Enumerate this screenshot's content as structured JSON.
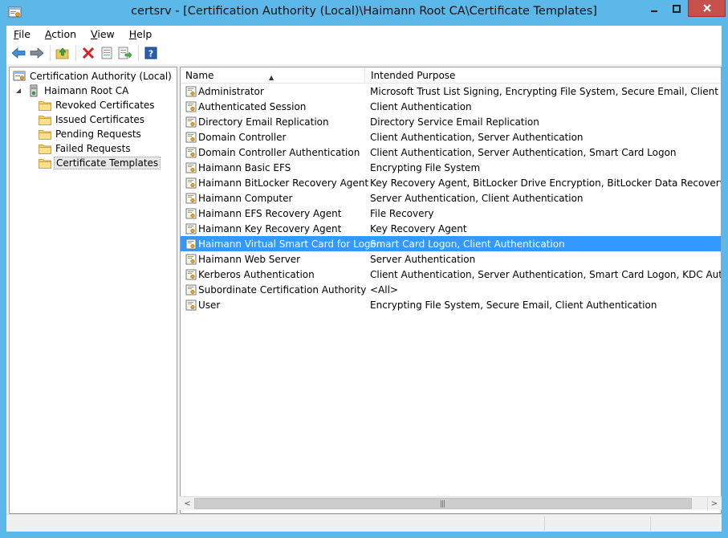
{
  "window": {
    "title": "certsrv - [Certification Authority (Local)\\Haimann Root CA\\Certificate Templates]",
    "icon": "certsrv-app-icon"
  },
  "menu": {
    "file": "File",
    "action": "Action",
    "view": "View",
    "help": "Help"
  },
  "toolbar": {
    "icons": [
      "back-arrow-icon",
      "forward-arrow-icon",
      "up-folder-icon",
      "delete-icon",
      "properties-icon",
      "export-list-icon",
      "help-icon"
    ]
  },
  "tree": {
    "root": "Certification Authority (Local)",
    "ca": "Haimann Root CA",
    "items": [
      {
        "label": "Revoked Certificates"
      },
      {
        "label": "Issued Certificates"
      },
      {
        "label": "Pending Requests"
      },
      {
        "label": "Failed Requests"
      },
      {
        "label": "Certificate Templates",
        "selected": true
      }
    ]
  },
  "list": {
    "columns": {
      "name": "Name",
      "purpose": "Intended Purpose"
    },
    "rows": [
      {
        "name": "Administrator",
        "purpose": "Microsoft Trust List Signing, Encrypting File System, Secure Email, Client Authenticati"
      },
      {
        "name": "Authenticated Session",
        "purpose": "Client Authentication"
      },
      {
        "name": "Directory Email Replication",
        "purpose": "Directory Service Email Replication"
      },
      {
        "name": "Domain Controller",
        "purpose": "Client Authentication, Server Authentication"
      },
      {
        "name": "Domain Controller Authentication",
        "purpose": "Client Authentication, Server Authentication, Smart Card Logon"
      },
      {
        "name": "Haimann Basic EFS",
        "purpose": "Encrypting File System"
      },
      {
        "name": "Haimann BitLocker Recovery Agent",
        "purpose": "Key Recovery Agent, BitLocker Drive Encryption, BitLocker Data Recovery Agent"
      },
      {
        "name": "Haimann Computer",
        "purpose": "Server Authentication, Client Authentication"
      },
      {
        "name": "Haimann EFS Recovery Agent",
        "purpose": "File Recovery"
      },
      {
        "name": "Haimann Key Recovery Agent",
        "purpose": "Key Recovery Agent"
      },
      {
        "name": "Haimann Virtual Smart Card for Logon",
        "purpose": "Smart Card Logon, Client Authentication",
        "selected": true
      },
      {
        "name": "Haimann Web Server",
        "purpose": "Server Authentication"
      },
      {
        "name": "Kerberos Authentication",
        "purpose": "Client Authentication, Server Authentication, Smart Card Logon, KDC Authentication"
      },
      {
        "name": "Subordinate Certification Authority",
        "purpose": "<All>"
      },
      {
        "name": "User",
        "purpose": "Encrypting File System, Secure Email, Client Authentication"
      }
    ]
  },
  "colors": {
    "frame": "#5bb8e8",
    "selection": "#3399ff",
    "close": "#c7504d"
  }
}
